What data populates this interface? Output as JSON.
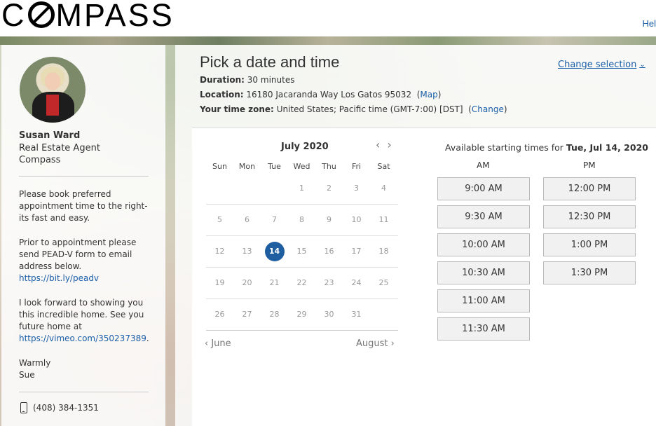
{
  "header": {
    "logo": "COMPASS",
    "logo_before_o": "C",
    "logo_after_o": "MPASS",
    "help": "Hel"
  },
  "profile": {
    "name": "Susan Ward",
    "title": "Real Estate Agent",
    "company": "Compass",
    "note_1": "Please book preferred appointment time to the right-its fast and easy.",
    "note_2": "Prior to appointment please send PEAD-V form to email address below.",
    "note_2_link": "https://bit.ly/peadv",
    "note_3": "I look forward to showing you this incredible home. See you future home at",
    "note_3_link": "https://vimeo.com/350237389",
    "note_3_end": ".",
    "signoff": "Warmly",
    "signature": "Sue",
    "phone": "(408) 384-1351"
  },
  "main": {
    "title": "Pick a date and time",
    "change_selection": "Change selection",
    "duration_label": "Duration:",
    "duration_value": "30 minutes",
    "location_label": "Location:",
    "location_value": "16180 Jacaranda Way Los Gatos 95032",
    "map_open": "(",
    "map_link": "Map",
    "map_close": ")",
    "tz_label": "Your time zone:",
    "tz_value": "United States;  Pacific time  (GMT-7:00) [DST]",
    "tz_open": "(",
    "tz_link": "Change",
    "tz_close": ")"
  },
  "calendar": {
    "month": "July 2020",
    "weekdays": [
      "Sun",
      "Mon",
      "Tue",
      "Wed",
      "Thu",
      "Fri",
      "Sat"
    ],
    "weeks": [
      [
        "",
        "",
        "",
        "1",
        "2",
        "3",
        "4"
      ],
      [
        "5",
        "6",
        "7",
        "8",
        "9",
        "10",
        "11"
      ],
      [
        "12",
        "13",
        "14",
        "15",
        "16",
        "17",
        "18"
      ],
      [
        "19",
        "20",
        "21",
        "22",
        "23",
        "24",
        "25"
      ],
      [
        "26",
        "27",
        "28",
        "29",
        "30",
        "31",
        ""
      ]
    ],
    "selected": "14",
    "prev_month": "June",
    "next_month": "August"
  },
  "availability": {
    "title_prefix": "Available starting times for",
    "title_date": "Tue, Jul 14, 2020",
    "am_label": "AM",
    "pm_label": "PM",
    "am_slots": [
      "9:00 AM",
      "9:30 AM",
      "10:00 AM",
      "10:30 AM",
      "11:00 AM",
      "11:30 AM"
    ],
    "pm_slots": [
      "12:00 PM",
      "12:30 PM",
      "1:00 PM",
      "1:30 PM"
    ]
  }
}
